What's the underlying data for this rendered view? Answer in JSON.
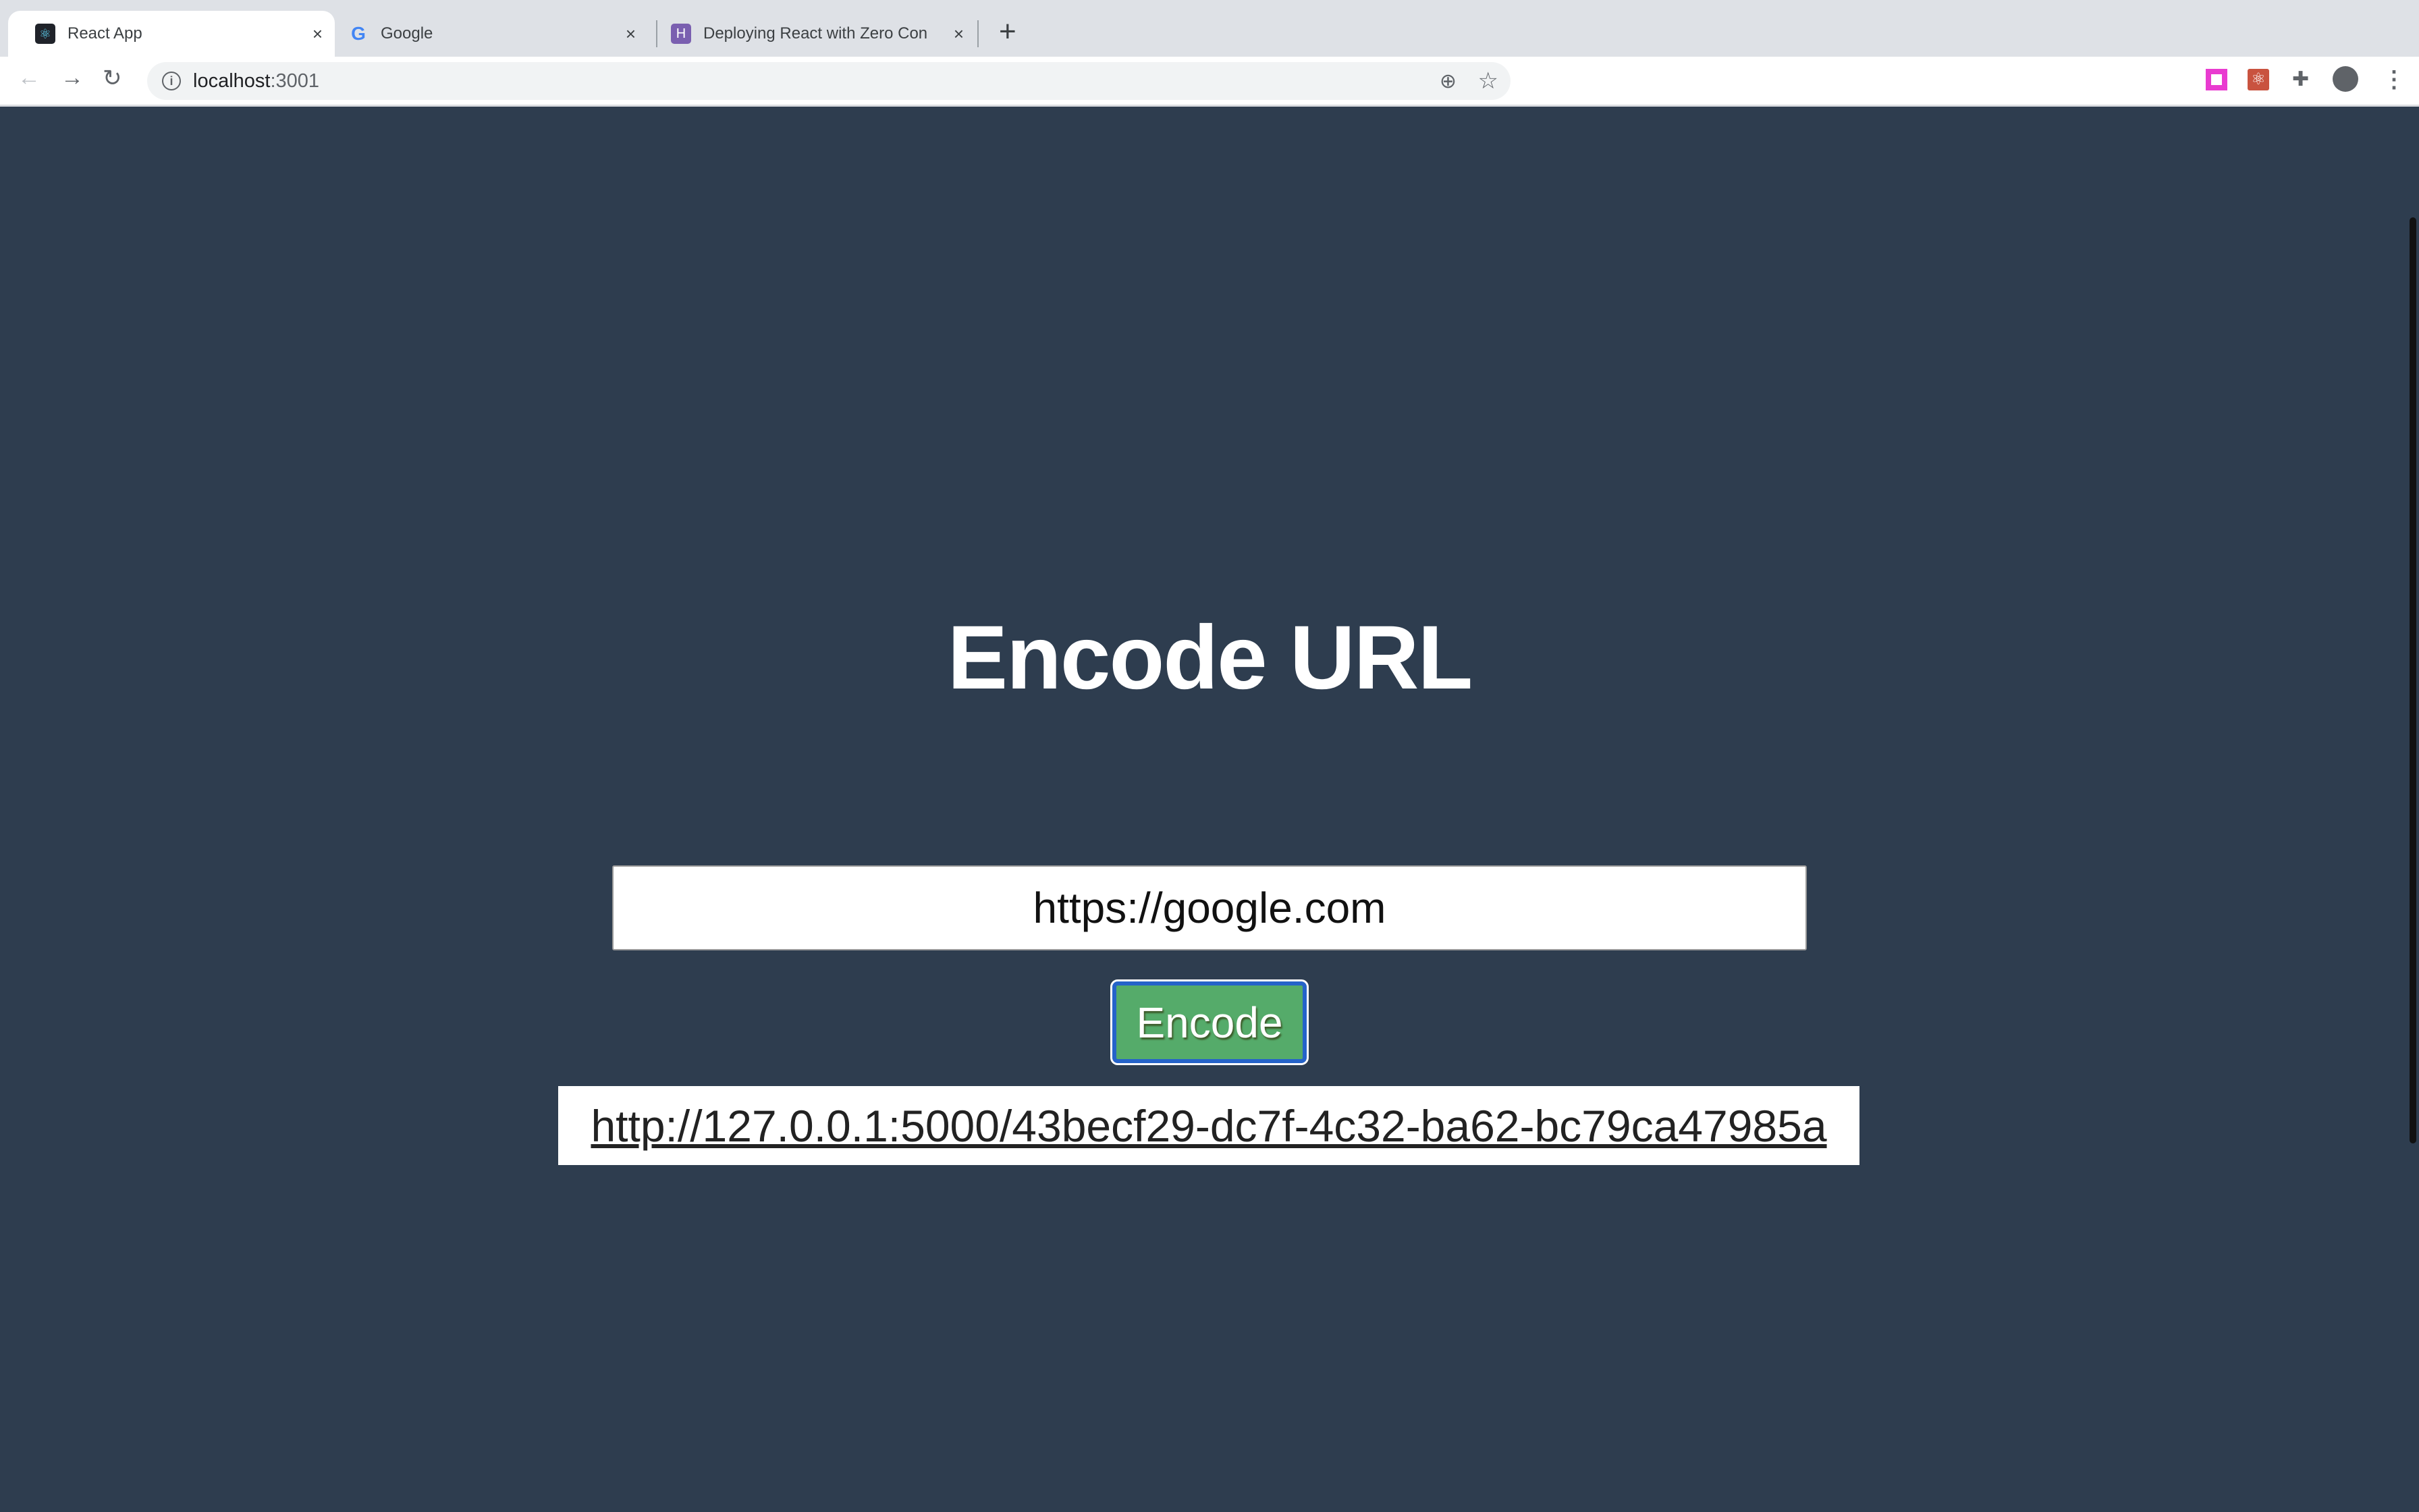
{
  "browser": {
    "tabs": [
      {
        "title": "React App",
        "icon": "react-icon",
        "active": true
      },
      {
        "title": "Google",
        "icon": "google-icon",
        "active": false
      },
      {
        "title": "Deploying React with Zero Con",
        "icon": "heroku-icon",
        "active": false
      }
    ],
    "new_tab": "+",
    "close": "×",
    "address": {
      "host": "localhost",
      "port": ":3001"
    }
  },
  "page": {
    "title": "Encode URL",
    "input_value": "https://google.com",
    "button_label": "Encode",
    "result_link": "http://127.0.0.1:5000/43becf29-dc7f-4c32-ba62-bc79ca47985a"
  },
  "colors": {
    "background": "#2e3d4f",
    "button": "#55ab6a",
    "focus_ring": "#2563c9"
  }
}
